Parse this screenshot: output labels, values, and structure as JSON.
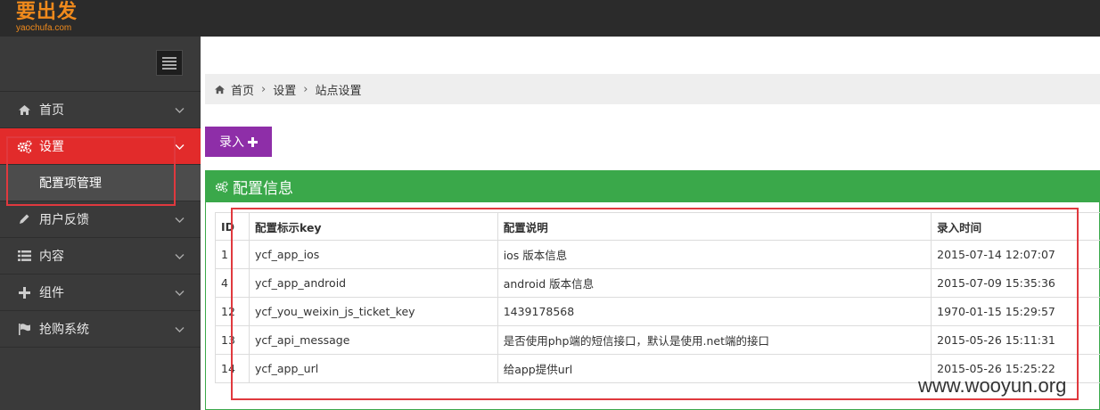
{
  "brand": {
    "title": "要出发",
    "domain": "yaochufa.com",
    "color": "#f08a1c"
  },
  "sidebar": {
    "items": [
      {
        "label": "首页",
        "icon": "home-icon"
      },
      {
        "label": "设置",
        "icon": "gears-icon",
        "active": true,
        "children": [
          {
            "label": "配置项管理"
          }
        ]
      },
      {
        "label": "用户反馈",
        "icon": "pencil-icon"
      },
      {
        "label": "内容",
        "icon": "list-icon"
      },
      {
        "label": "组件",
        "icon": "plus-icon"
      },
      {
        "label": "抢购系统",
        "icon": "flag-icon"
      }
    ]
  },
  "breadcrumb": [
    "首页",
    "设置",
    "站点设置"
  ],
  "add_button": {
    "label": "录入"
  },
  "panel": {
    "title": "配置信息"
  },
  "table": {
    "headers": [
      "ID",
      "配置标示key",
      "配置说明",
      "录入时间"
    ],
    "rows": [
      [
        "1",
        "ycf_app_ios",
        "ios 版本信息",
        "2015-07-14 12:07:07"
      ],
      [
        "4",
        "ycf_app_android",
        "android 版本信息",
        "2015-07-09 15:35:36"
      ],
      [
        "12",
        "ycf_you_weixin_js_ticket_key",
        "1439178568",
        "1970-01-15 15:29:57"
      ],
      [
        "13",
        "ycf_api_message",
        "是否使用php端的短信接口，默认是使用.net端的接口",
        "2015-05-26 15:11:31"
      ],
      [
        "14",
        "ycf_app_url",
        "给app提供url",
        "2015-05-26 15:25:22"
      ]
    ]
  },
  "watermark": "www.wooyun.org",
  "colors": {
    "active_nav": "#e22b2b",
    "add_button": "#8e2ea8",
    "panel": "#3aa84a",
    "annotation": "#e0393e"
  }
}
